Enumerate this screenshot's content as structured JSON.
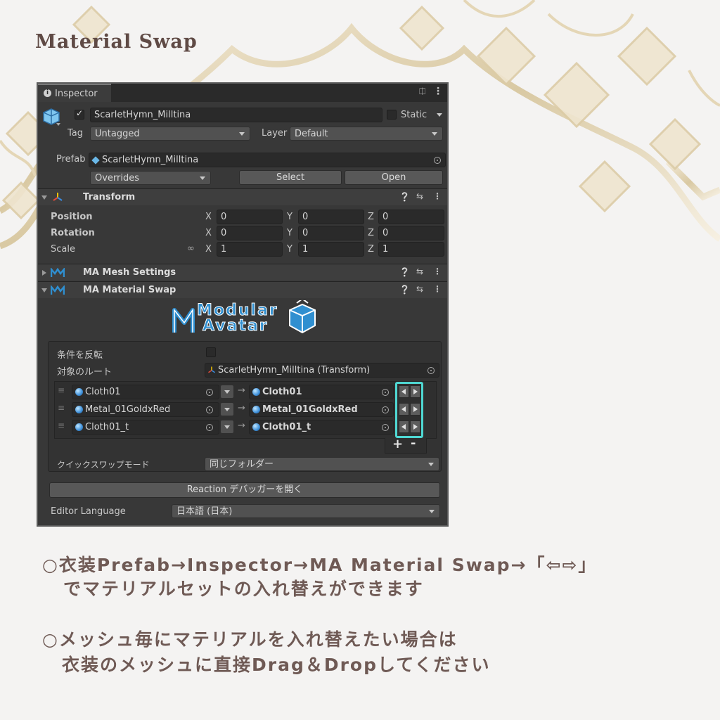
{
  "page": {
    "title": "Material Swap"
  },
  "inspector": {
    "tab_label": "Inspector",
    "object": {
      "name": "ScarletHymn_Milltina",
      "active": true,
      "static_label": "Static"
    },
    "tag": {
      "label": "Tag",
      "value": "Untagged"
    },
    "layer": {
      "label": "Layer",
      "value": "Default"
    },
    "prefab": {
      "label": "Prefab",
      "value": "ScarletHymn_Milltina",
      "overrides": "Overrides",
      "select": "Select",
      "open": "Open"
    },
    "transform": {
      "title": "Transform",
      "rows": [
        {
          "label": "Position",
          "x": "0",
          "y": "0",
          "z": "0"
        },
        {
          "label": "Rotation",
          "x": "0",
          "y": "0",
          "z": "0"
        },
        {
          "label": "Scale",
          "x": "1",
          "y": "1",
          "z": "1"
        }
      ],
      "axes": [
        "X",
        "Y",
        "Z"
      ]
    },
    "components": {
      "mesh_settings": "MA Mesh Settings",
      "material_swap": "MA Material Swap"
    },
    "logo": {
      "line1": "Modular",
      "line2": "Avatar"
    },
    "swap": {
      "invert_label": "条件を反転",
      "root_label": "対象のルート",
      "root_value": "ScarletHymn_Milltina (Transform)",
      "rows": [
        {
          "from": "Cloth01",
          "to": "Cloth01"
        },
        {
          "from": "Metal_01GoldxRed",
          "to": "Metal_01GoldxRed"
        },
        {
          "from": "Cloth01_t",
          "to": "Cloth01_t"
        }
      ],
      "add": "+",
      "remove": "-",
      "quick_mode_label": "クイックスワップモード",
      "quick_mode_value": "同じフォルダー",
      "reaction_button": "Reaction デバッガーを開く",
      "editor_language_label": "Editor Language",
      "editor_language_value": "日本語 (日本)"
    }
  },
  "instructions": {
    "line1": "○衣装Prefab→Inspector→MA Material Swap→「⇦⇨」",
    "line2": "でマテリアルセットの入れ替えができます",
    "line3": "○メッシュ毎にマテリアルを入れ替えたい場合は",
    "line4": "衣装のメッシュに直接Drag＆Dropしてください"
  },
  "colors": {
    "highlight": "#4fd7d2",
    "logo_blue": "#2f8fd0",
    "text_brown": "#6f5a55"
  }
}
